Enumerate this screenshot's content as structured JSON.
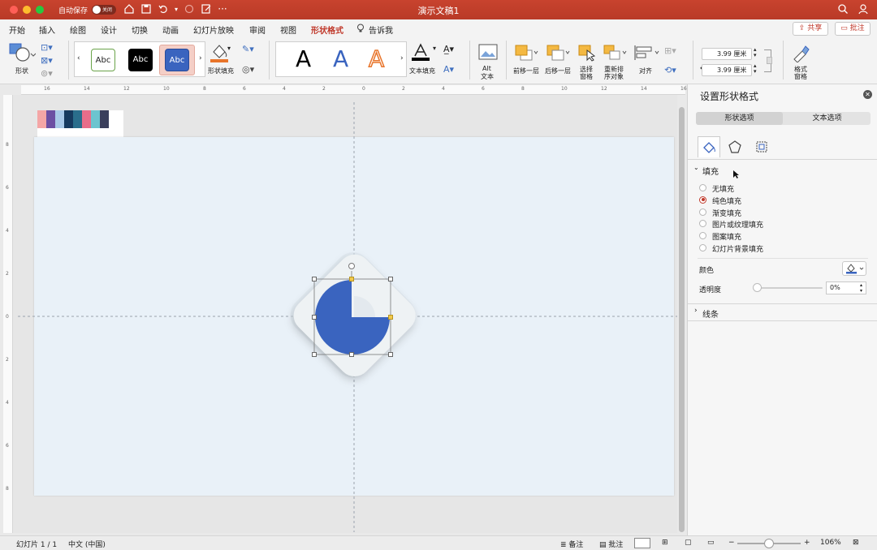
{
  "titlebar": {
    "autosave_label": "自动保存",
    "toggle_label": "关闭",
    "title": "演示文稿1"
  },
  "tabs": [
    {
      "label": "开始"
    },
    {
      "label": "插入"
    },
    {
      "label": "绘图"
    },
    {
      "label": "设计"
    },
    {
      "label": "切换"
    },
    {
      "label": "动画"
    },
    {
      "label": "幻灯片放映"
    },
    {
      "label": "审阅"
    },
    {
      "label": "视图"
    },
    {
      "label": "形状格式",
      "active": true
    },
    {
      "label": "告诉我"
    }
  ],
  "header_buttons": {
    "share": "共享",
    "comment": "批注"
  },
  "ribbon": {
    "shapes_label": "形状",
    "style_gallery": [
      "Abc",
      "Abc",
      "Abc"
    ],
    "shape_fill_label": "形状填充",
    "wordart_letters": [
      "A",
      "A",
      "A"
    ],
    "text_fill_label": "文本填充",
    "alt_text_label": "Alt\n文本",
    "alt_text_line1": "Alt",
    "alt_text_line2": "文本",
    "bring_forward": "前移一层",
    "send_backward": "后移一层",
    "selection_pane_1": "选择",
    "selection_pane_2": "窗格",
    "reorder_1": "重新排",
    "reorder_2": "序对象",
    "align": "对齐",
    "height_value": "3.99 厘米",
    "width_value": "3.99 厘米",
    "format_pane_1": "格式",
    "format_pane_2": "窗格"
  },
  "ruler": {
    "h_ticks": [
      "16",
      "14",
      "12",
      "10",
      "8",
      "6",
      "4",
      "2",
      "0",
      "2",
      "4",
      "6",
      "8",
      "10",
      "12",
      "14",
      "16"
    ],
    "v_ticks": [
      "8",
      "6",
      "4",
      "2",
      "0",
      "2",
      "4",
      "6",
      "8"
    ]
  },
  "palette_colors": [
    "#f4a6a6",
    "#6c4fa3",
    "#a9c9e8",
    "#163a5f",
    "#2a6e8c",
    "#e86d8a",
    "#6cc4cf",
    "#3a3f5c"
  ],
  "colors": {
    "accent": "#c0392b",
    "shape_blue": "#3a64bf",
    "slide_bg": "#e9f1f8"
  },
  "pane": {
    "title": "设置形状格式",
    "tab_shape": "形状选项",
    "tab_text": "文本选项",
    "fill_section": "填充",
    "fill_options": [
      {
        "label": "无填充",
        "selected": false
      },
      {
        "label": "纯色填充",
        "selected": true
      },
      {
        "label": "渐变填充",
        "selected": false
      },
      {
        "label": "图片或纹理填充",
        "selected": false
      },
      {
        "label": "图案填充",
        "selected": false
      },
      {
        "label": "幻灯片背景填充",
        "selected": false
      }
    ],
    "color_label": "颜色",
    "transparency_label": "透明度",
    "transparency_value": "0%",
    "line_section": "线条"
  },
  "status": {
    "slide_info": "幻灯片 1 / 1",
    "language": "中文 (中国)",
    "notes": "备注",
    "comments": "批注",
    "zoom": "106%"
  }
}
